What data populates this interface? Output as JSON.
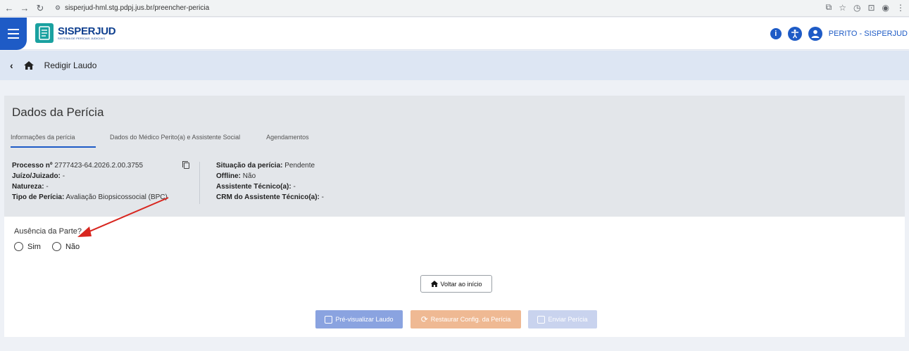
{
  "browser": {
    "url": "sisperjud-hml.stg.pdpj.jus.br/preencher-pericia",
    "back_icon": "arrow-left-icon",
    "forward_icon": "arrow-right-icon",
    "reload_icon": "reload-icon"
  },
  "header": {
    "logo_title": "SISPERJUD",
    "logo_subtitle": "SISTEMA DE PERÍCIAS JUDICIAIS",
    "user_label": "PERITO - SISPERJUD",
    "accent_color": "#1e5bc6"
  },
  "breadcrumb": {
    "title": "Redigir Laudo"
  },
  "card": {
    "title": "Dados da Perícia",
    "tabs": [
      {
        "label": "Informações da perícia",
        "active": true
      },
      {
        "label": "Dados do Médico Perito(a) e Assistente Social",
        "active": false
      },
      {
        "label": "Agendamentos",
        "active": false
      }
    ],
    "info_left": [
      {
        "label": "Processo nº",
        "value": "2777423-64.2026.2.00.3755"
      },
      {
        "label": "Juízo/Juizado:",
        "value": "-"
      },
      {
        "label": "Natureza:",
        "value": "-"
      },
      {
        "label": "Tipo de Perícia:",
        "value": "Avaliação Biopsicossocial (BPC)"
      }
    ],
    "info_right": [
      {
        "label": "Situação da perícia:",
        "value": "Pendente"
      },
      {
        "label": "Offline:",
        "value": "Não"
      },
      {
        "label": "Assistente Técnico(a):",
        "value": "-"
      },
      {
        "label": "CRM do Assistente Técnico(a):",
        "value": "-"
      }
    ]
  },
  "form": {
    "absence_label": "Ausência da Parte?",
    "option_yes": "Sim",
    "option_no": "Não"
  },
  "buttons": {
    "home": "Voltar ao início",
    "preview": "Pré-visualizar Laudo",
    "restore": "Restaurar Config. da Perícia",
    "send": "Enviar Perícia"
  }
}
